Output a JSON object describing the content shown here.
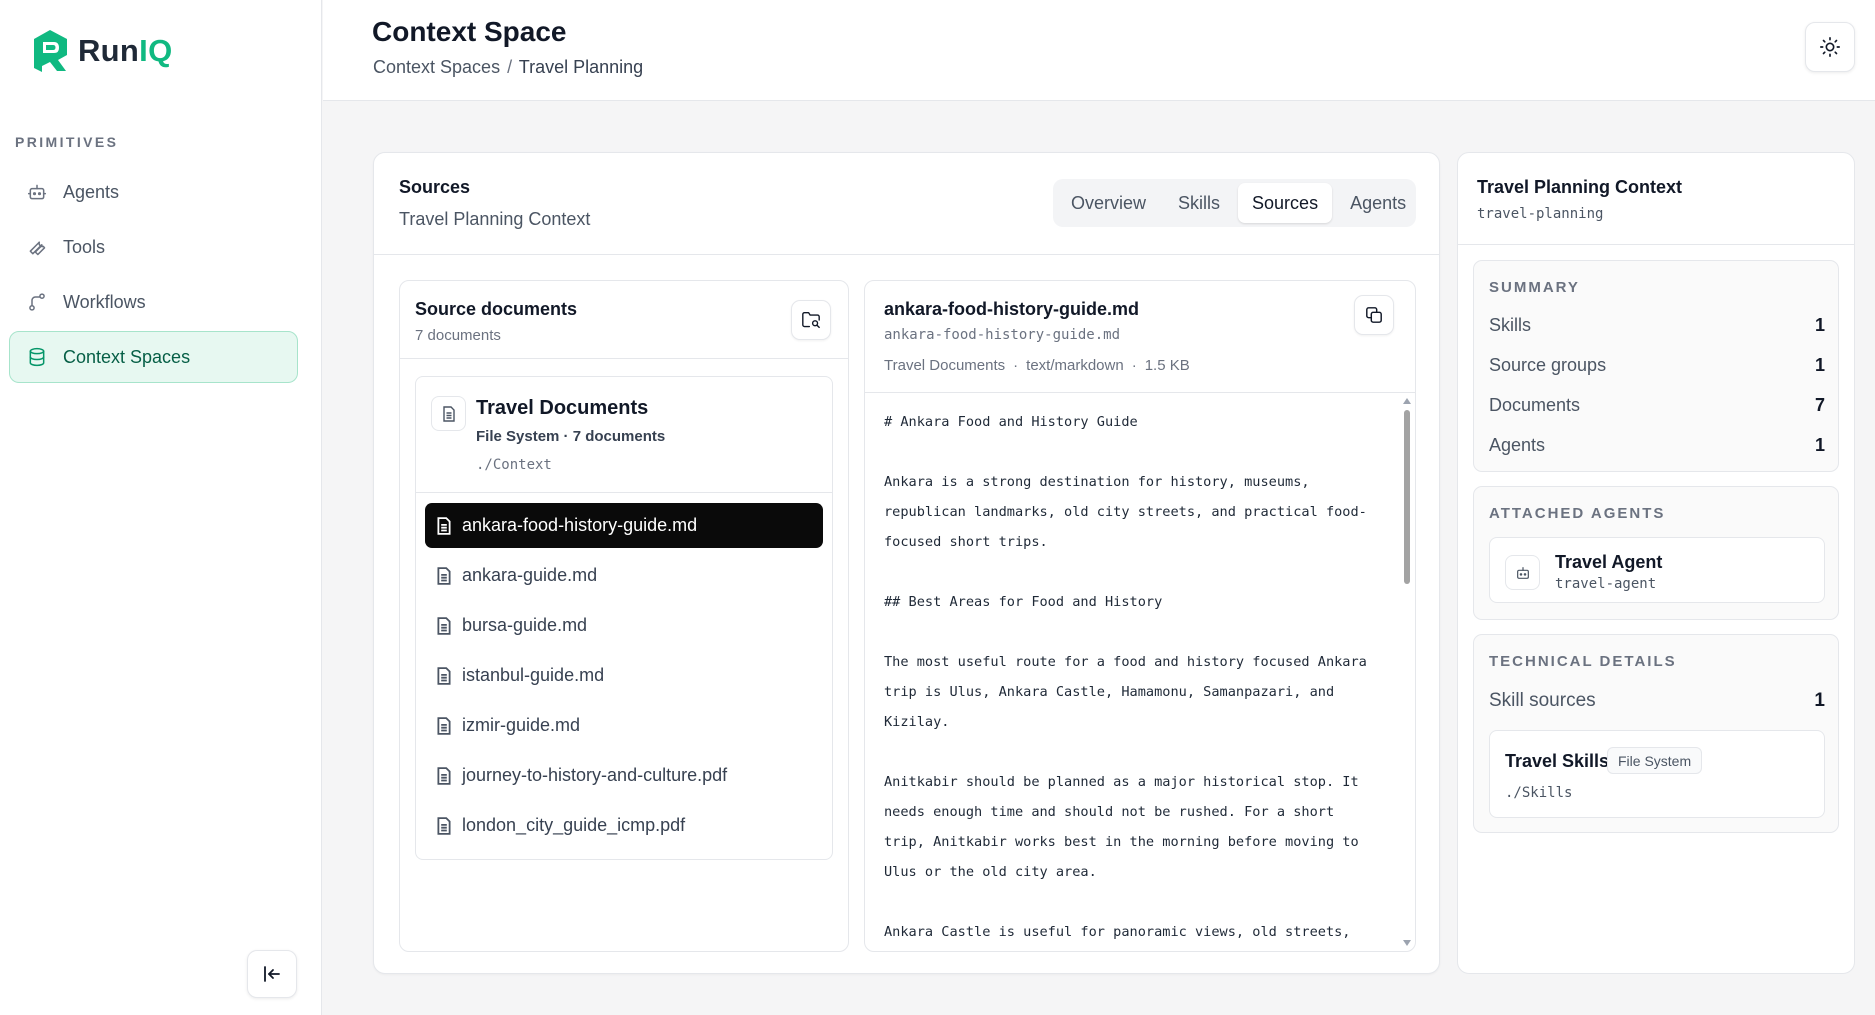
{
  "app": {
    "name_part1": "Run",
    "name_part2": "IQ"
  },
  "sidebar": {
    "section_label": "PRIMITIVES",
    "items": [
      {
        "label": "Agents",
        "icon": "bot-icon"
      },
      {
        "label": "Tools",
        "icon": "wrench-icon"
      },
      {
        "label": "Workflows",
        "icon": "workflow-icon"
      },
      {
        "label": "Context Spaces",
        "icon": "database-icon",
        "active": true
      }
    ]
  },
  "header": {
    "title": "Context Space",
    "breadcrumb": {
      "parent": "Context Spaces",
      "separator": "/",
      "current": "Travel Planning"
    }
  },
  "main": {
    "title": "Sources",
    "subtitle": "Travel Planning Context",
    "tabs": [
      {
        "label": "Overview"
      },
      {
        "label": "Skills"
      },
      {
        "label": "Sources",
        "active": true
      },
      {
        "label": "Agents"
      }
    ]
  },
  "source_docs": {
    "title": "Source documents",
    "count": "7 documents",
    "group": {
      "title": "Travel Documents",
      "meta": "File System · 7 documents",
      "path": "./Context"
    },
    "files": [
      "ankara-food-history-guide.md",
      "ankara-guide.md",
      "bursa-guide.md",
      "istanbul-guide.md",
      "izmir-guide.md",
      "journey-to-history-and-culture.pdf",
      "london_city_guide_icmp.pdf"
    ]
  },
  "viewer": {
    "title": "ankara-food-history-guide.md",
    "filename": "ankara-food-history-guide.md",
    "meta": {
      "group": "Travel Documents",
      "type": "text/markdown",
      "size": "1.5 KB",
      "dot": "·"
    },
    "content": "# Ankara Food and History Guide\n\nAnkara is a strong destination for history, museums,\nrepublican landmarks, old city streets, and practical food-\nfocused short trips.\n\n## Best Areas for Food and History\n\nThe most useful route for a food and history focused Ankara\ntrip is Ulus, Ankara Castle, Hamamonu, Samanpazari, and\nKizilay.\n\nAnitkabir should be planned as a major historical stop. It\nneeds enough time and should not be rushed. For a short\ntrip, Anitkabir works best in the morning before moving to\nUlus or the old city area.\n\nAnkara Castle is useful for panoramic views, old streets,"
  },
  "context": {
    "title": "Travel Planning Context",
    "slug": "travel-planning",
    "summary": {
      "label": "SUMMARY",
      "rows": [
        {
          "label": "Skills",
          "value": "1"
        },
        {
          "label": "Source groups",
          "value": "1"
        },
        {
          "label": "Documents",
          "value": "7"
        },
        {
          "label": "Agents",
          "value": "1"
        }
      ]
    },
    "attached_agents": {
      "label": "ATTACHED AGENTS",
      "agent": {
        "name": "Travel Agent",
        "slug": "travel-agent"
      }
    },
    "technical": {
      "label": "TECHNICAL DETAILS",
      "skill_sources_label": "Skill sources",
      "skill_sources_value": "1",
      "skill": {
        "name": "Travel Skills",
        "badge": "File System",
        "path": "./Skills"
      }
    }
  },
  "colors": {
    "accent": "#10b981",
    "active_bg": "#e7f8f1",
    "selected_file_bg": "#0a0a0a"
  }
}
